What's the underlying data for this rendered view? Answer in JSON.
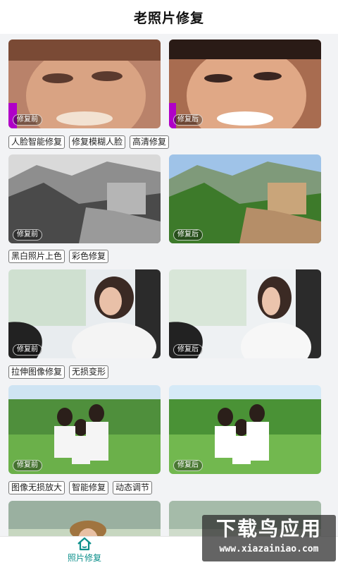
{
  "header": {
    "title": "老照片修复"
  },
  "before_label": "修复前",
  "after_label": "修复后",
  "sections": [
    {
      "id": "face",
      "tags": [
        "人脸智能修复",
        "修复模糊人脸",
        "高清修复"
      ]
    },
    {
      "id": "color",
      "tags": [
        "黑白照片上色",
        "彩色修复"
      ]
    },
    {
      "id": "stretch",
      "tags": [
        "拉伸图像修复",
        "无损变形"
      ]
    },
    {
      "id": "enlarge",
      "tags": [
        "图像无损放大",
        "智能修复",
        "动态调节"
      ]
    }
  ],
  "tabbar": {
    "home_label": "照片修复",
    "home_icon": "house-icon",
    "accent": "#0b8f8b"
  },
  "watermark": {
    "title": "下载鸟应用",
    "url": "www.xiazainiao.com"
  }
}
